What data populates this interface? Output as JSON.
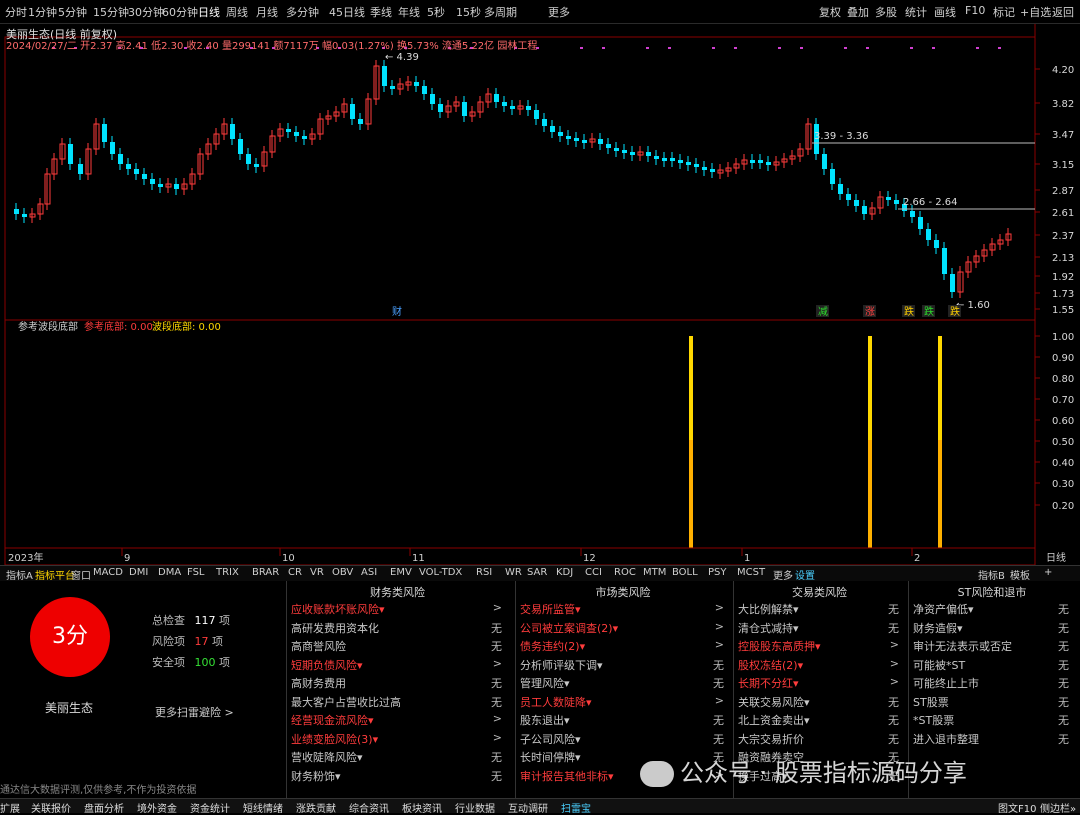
{
  "toolbar": {
    "left": [
      "分时",
      "1分钟",
      "5分钟",
      "15分钟",
      "30分钟",
      "60分钟",
      "日线",
      "周线",
      "月线",
      "多分钟",
      "45日线",
      "季线",
      "年线",
      "5秒",
      "15秒",
      "多周期",
      "更多"
    ],
    "right": [
      "复权",
      "叠加",
      "多股",
      "统计",
      "画线",
      "F10",
      "标记",
      "+自选",
      "返回"
    ]
  },
  "header": {
    "title": "美丽生态(日线 前复权)",
    "quote": "2024/02/27/二 开2.37 高2.41 低2.30 收2.40 量299141 额7117万 幅0.03(1.27%) 换5.73% 流通5.22亿 园林工程"
  },
  "main_chart": {
    "price_ticks": [
      "4.20",
      "3.82",
      "3.47",
      "3.15",
      "2.87",
      "2.61",
      "2.37",
      "2.13",
      "1.92",
      "1.73",
      "1.55"
    ],
    "annotations": {
      "high": "4.39",
      "low": "1.60",
      "level1": "3.39 - 3.36",
      "level2": "2.66 - 2.64"
    },
    "markers": [
      {
        "text": "财",
        "color": "#4aa0ff"
      },
      {
        "text": "减",
        "color": "#2cdc2c"
      },
      {
        "text": "涨",
        "color": "#ff4040"
      },
      {
        "text": "跌",
        "color": "#ffd000"
      },
      {
        "text": "跌",
        "color": "#2cdc2c"
      },
      {
        "text": "跌",
        "color": "#ffd000"
      }
    ]
  },
  "indicator": {
    "name": "参考波段底部",
    "label1": "参考底部: 0.00",
    "label2": "波段底部: 0.00",
    "ticks": [
      "1.00",
      "0.90",
      "0.80",
      "0.70",
      "0.60",
      "0.50",
      "0.40",
      "0.30",
      "0.20"
    ]
  },
  "x_axis": {
    "labels": [
      "2023年",
      "9",
      "10",
      "11",
      "12",
      "1",
      "2"
    ],
    "period": "日线"
  },
  "indicator_tabs": [
    "指标A",
    "指标平台",
    "窗口",
    "MACD",
    "DMI",
    "DMA",
    "FSL",
    "TRIX",
    "BRAR",
    "CR",
    "VR",
    "OBV",
    "ASI",
    "EMV",
    "VOL-TDX",
    "RSI",
    "WR",
    "SAR",
    "KDJ",
    "CCI",
    "ROC",
    "MTM",
    "BOLL",
    "PSY",
    "MCST",
    "更多",
    "设置"
  ],
  "indicator_tabs_right": [
    "指标B",
    "模板",
    "+"
  ],
  "scan": {
    "score": "3分",
    "stock_name": "美丽生态",
    "total_label": "总检查",
    "total_value": "117",
    "total_unit": "项",
    "risk_label": "风险项",
    "risk_value": "17",
    "risk_unit": "项",
    "safe_label": "安全项",
    "safe_value": "100",
    "safe_unit": "项",
    "more": "更多扫雷避险 >",
    "disclaimer": "通达信大数据评测,仅供参考,不作为投资依据",
    "columns": [
      {
        "title": "财务类风险",
        "items": [
          {
            "label": "应收账款坏账风险▾",
            "val": ">",
            "risk": true
          },
          {
            "label": "高研发费用资本化",
            "val": "无",
            "risk": false
          },
          {
            "label": "高商誉风险",
            "val": "无",
            "risk": false
          },
          {
            "label": "短期负债风险▾",
            "val": ">",
            "risk": true
          },
          {
            "label": "高财务费用",
            "val": "无",
            "risk": false
          },
          {
            "label": "最大客户占营收比过高",
            "val": "无",
            "risk": false
          },
          {
            "label": "经营现金流风险▾",
            "val": ">",
            "risk": true
          },
          {
            "label": "业绩变脸风险(3)▾",
            "val": ">",
            "risk": true
          },
          {
            "label": "营收陡降风险▾",
            "val": "无",
            "risk": false
          },
          {
            "label": "财务粉饰▾",
            "val": "无",
            "risk": false
          }
        ]
      },
      {
        "title": "市场类风险",
        "items": [
          {
            "label": "交易所监管▾",
            "val": ">",
            "risk": true
          },
          {
            "label": "公司被立案调查(2)▾",
            "val": ">",
            "risk": true
          },
          {
            "label": "债务违约(2)▾",
            "val": ">",
            "risk": true
          },
          {
            "label": "分析师评级下调▾",
            "val": "无",
            "risk": false
          },
          {
            "label": "管理风险▾",
            "val": "无",
            "risk": false
          },
          {
            "label": "员工人数陡降▾",
            "val": ">",
            "risk": true
          },
          {
            "label": "股东退出▾",
            "val": "无",
            "risk": false
          },
          {
            "label": "子公司风险▾",
            "val": "无",
            "risk": false
          },
          {
            "label": "长时间停牌▾",
            "val": "无",
            "risk": false
          },
          {
            "label": "审计报告其他非标▾",
            "val": ">",
            "risk": true
          }
        ]
      },
      {
        "title": "交易类风险",
        "items": [
          {
            "label": "大比例解禁▾",
            "val": "无",
            "risk": false
          },
          {
            "label": "清仓式减持▾",
            "val": "无",
            "risk": false
          },
          {
            "label": "控股股东高质押▾",
            "val": ">",
            "risk": true
          },
          {
            "label": "股权冻结(2)▾",
            "val": ">",
            "risk": true
          },
          {
            "label": "长期不分红▾",
            "val": ">",
            "risk": true
          },
          {
            "label": "关联交易风险▾",
            "val": "无",
            "risk": false
          },
          {
            "label": "北上资金卖出▾",
            "val": "无",
            "risk": false
          },
          {
            "label": "大宗交易折价",
            "val": "无",
            "risk": false
          },
          {
            "label": "融资融券卖空",
            "val": "无",
            "risk": false
          },
          {
            "label": "换手过高▾",
            "val": "无",
            "risk": false
          }
        ]
      },
      {
        "title": "ST风险和退市",
        "items": [
          {
            "label": "净资产偏低▾",
            "val": "无",
            "risk": false
          },
          {
            "label": "财务造假▾",
            "val": "无",
            "risk": false
          },
          {
            "label": "审计无法表示或否定",
            "val": "无",
            "risk": false
          },
          {
            "label": "可能被*ST",
            "val": "无",
            "risk": false
          },
          {
            "label": "可能终止上市",
            "val": "无",
            "risk": false
          },
          {
            "label": "ST股票",
            "val": "无",
            "risk": false
          },
          {
            "label": "*ST股票",
            "val": "无",
            "risk": false
          },
          {
            "label": "进入退市整理",
            "val": "无",
            "risk": false
          }
        ]
      }
    ]
  },
  "watermark": "公众号 · 股票指标源码分享",
  "statusbar": [
    "扩展",
    "关联报价",
    "盘面分析",
    "境外资金",
    "资金统计",
    "短线情绪",
    "涨跌贡献",
    "综合资讯",
    "板块资讯",
    "行业数据",
    "互动调研",
    "扫雷宝"
  ],
  "statusbar_right": [
    "图文F10",
    "侧边栏»"
  ],
  "colors": {
    "up": "#ff3c3c",
    "down": "#00e4ff",
    "signal": "#ffd800",
    "score_bg": "#e60000"
  }
}
